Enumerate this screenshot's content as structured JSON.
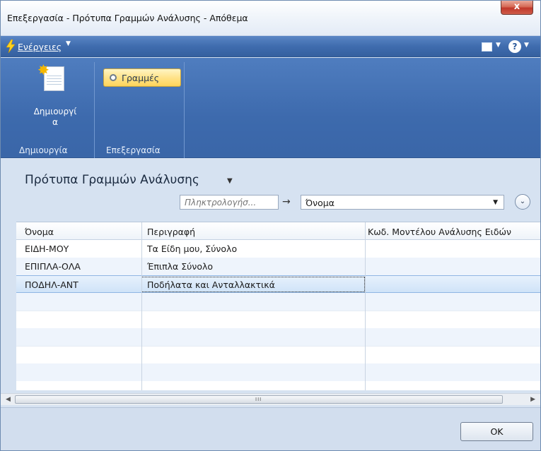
{
  "window": {
    "title": "Επεξεργασία - Πρότυπα Γραμμών Ανάλυσης - Απόθεμα",
    "close_label": "x"
  },
  "actionbar": {
    "actions_label": "Ενέργειες",
    "help_label": "?"
  },
  "ribbon": {
    "create_group": {
      "label": "Δημιουργία",
      "new_button": "Δημιουργία"
    },
    "edit_group": {
      "label": "Επεξεργασία",
      "lines_button": "Γραμμές"
    }
  },
  "page": {
    "title": "Πρότυπα Γραμμών Ανάλυσης"
  },
  "filter": {
    "placeholder": "Πληκτρολογήσ...",
    "field_value": "Όνομα"
  },
  "grid": {
    "columns": [
      "Όνομα",
      "Περιγραφή",
      "Κωδ. Μοντέλου Ανάλυσης Ειδών"
    ],
    "rows": [
      {
        "name": "ΕΙΔΗ-ΜΟΥ",
        "description": "Τα Είδη μου, Σύνολο",
        "code": ""
      },
      {
        "name": "ΕΠΙΠΛΑ-ΟΛΑ",
        "description": "Έπιπλα Σύνολο",
        "code": ""
      },
      {
        "name": "ΠΟΔΗΛ-ΑΝΤ",
        "description": "Ποδήλατα και Ανταλλακτικά",
        "code": ""
      }
    ],
    "selected_row": 2
  },
  "footer": {
    "ok_label": "OK"
  },
  "colors": {
    "accent": "#3d6aad",
    "selection": "#cfe3f8",
    "highlight_button": "#ffd45a"
  }
}
